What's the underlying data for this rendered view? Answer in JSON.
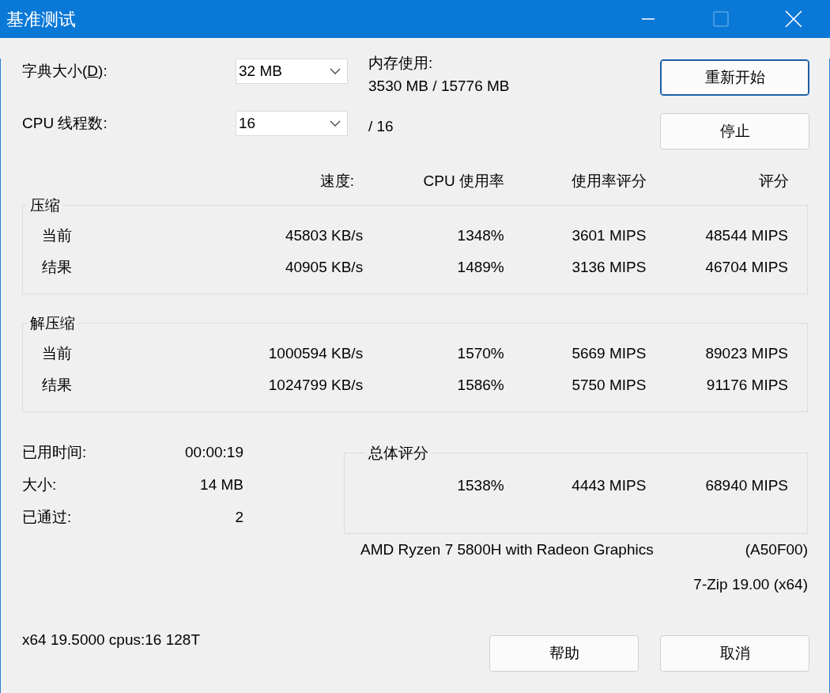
{
  "window": {
    "title": "基准测试",
    "title_buttons": [
      {
        "kind": "minimize",
        "disabled": false
      },
      {
        "kind": "maximize",
        "disabled": true
      },
      {
        "kind": "close",
        "disabled": false
      }
    ]
  },
  "settings": [
    {
      "label_before": "字典大小(",
      "access_key": "D",
      "label_after": "):",
      "value": "32 MB"
    },
    {
      "label_before": "CPU 线程数:",
      "value": "16"
    }
  ],
  "memory": {
    "label": "内存使用:",
    "value": "3530 MB / 15776 MB"
  },
  "threads_total": "/ 16",
  "top_buttons": [
    {
      "label": "重新开始",
      "focused": true
    },
    {
      "label": "停止",
      "focused": false
    }
  ],
  "columns": [
    "速度:",
    "CPU 使用率",
    "使用率评分",
    "评分"
  ],
  "groups": [
    {
      "title": "压缩",
      "rows": [
        {
          "label": "当前",
          "cells": [
            "45803 KB/s",
            "1348%",
            "3601 MIPS",
            "48544 MIPS"
          ]
        },
        {
          "label": "结果",
          "cells": [
            "40905 KB/s",
            "1489%",
            "3136 MIPS",
            "46704 MIPS"
          ]
        }
      ]
    },
    {
      "title": "解压缩",
      "rows": [
        {
          "label": "当前",
          "cells": [
            "1000594 KB/s",
            "1570%",
            "5669 MIPS",
            "89023 MIPS"
          ]
        },
        {
          "label": "结果",
          "cells": [
            "1024799 KB/s",
            "1586%",
            "5750 MIPS",
            "91176 MIPS"
          ]
        }
      ]
    }
  ],
  "stats": [
    {
      "label": "已用时间:",
      "value": "00:00:19"
    },
    {
      "label": "大小:",
      "value": "14 MB"
    },
    {
      "label": "已通过:",
      "value": "2"
    }
  ],
  "total": {
    "title": "总体评分",
    "cells": [
      "1538%",
      "4443 MIPS",
      "68940 MIPS"
    ]
  },
  "cpu": {
    "name": "AMD Ryzen 7 5800H with Radeon Graphics",
    "id": "(A50F00)"
  },
  "version": "7-Zip 19.00 (x64)",
  "footer_info": "x64 19.5000 cpus:16 128T",
  "bottom_buttons": [
    {
      "label": "帮助",
      "focused": false
    },
    {
      "label": "取消",
      "focused": false
    }
  ]
}
